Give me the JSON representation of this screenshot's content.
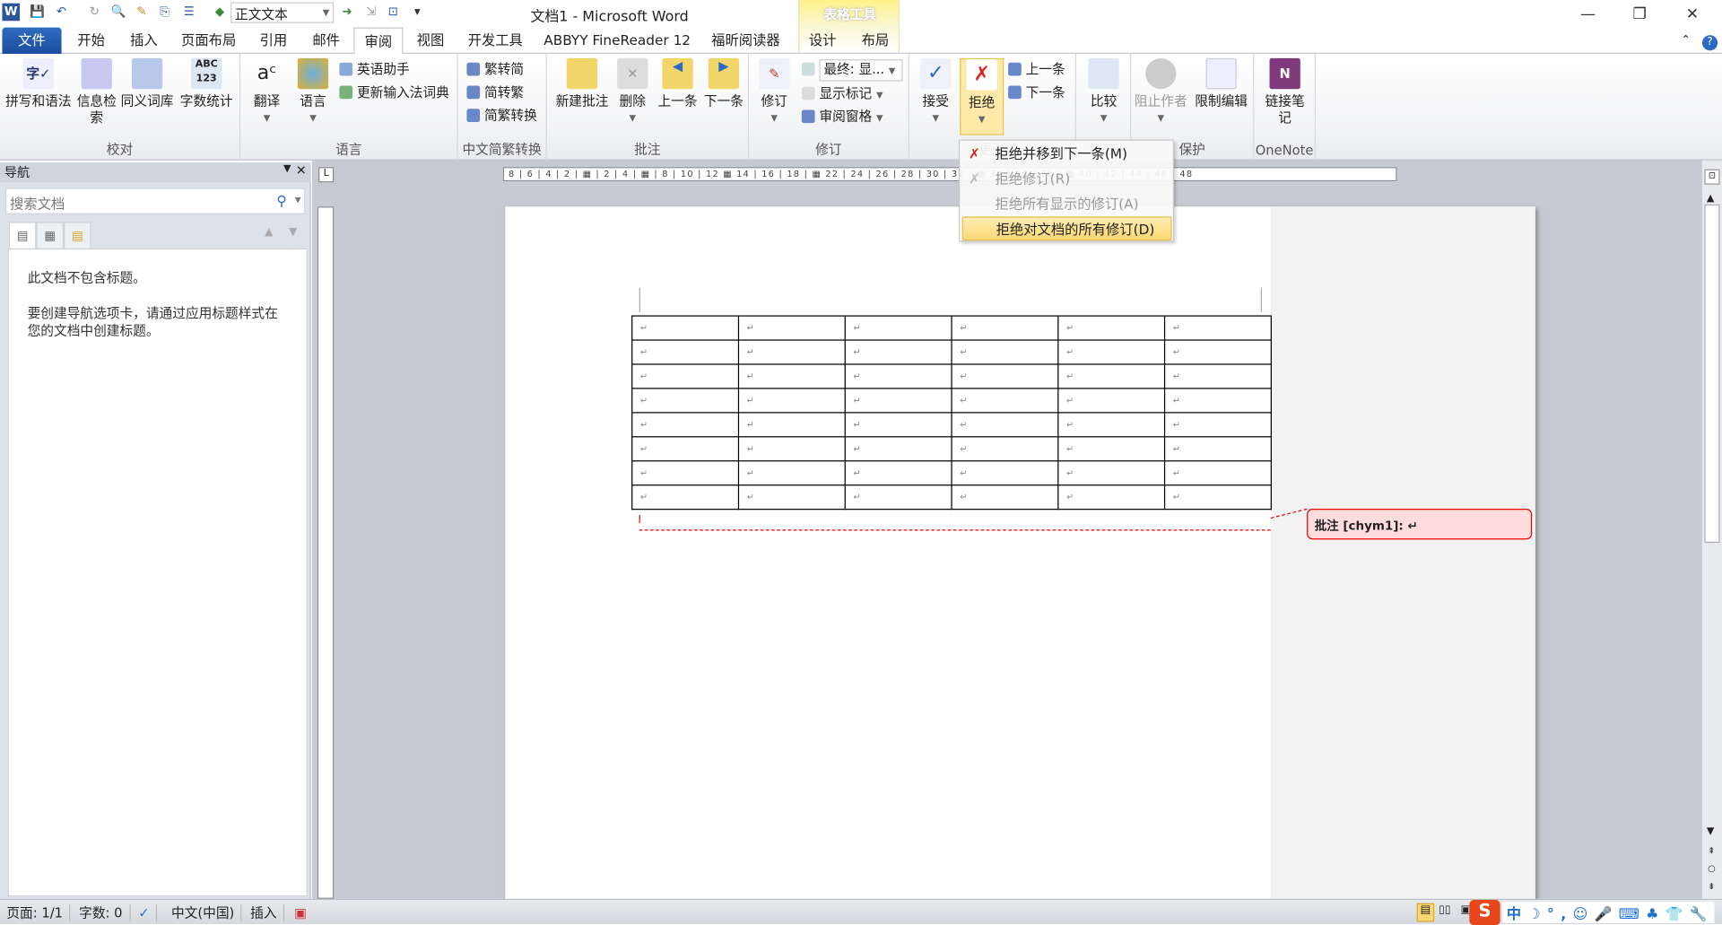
{
  "titlebar": {
    "title": "文档1 - Microsoft Word",
    "style_box": "正文文本",
    "contextual_tab": "表格工具"
  },
  "tabs": [
    "文件",
    "开始",
    "插入",
    "页面布局",
    "引用",
    "邮件",
    "审阅",
    "视图",
    "开发工具",
    "ABBYY FineReader 12",
    "福昕阅读器",
    "设计",
    "布局"
  ],
  "active_tab": "审阅",
  "ribbon": {
    "proofing": {
      "label": "校对",
      "buttons": [
        "拼写和语法",
        "信息检索",
        "同义词库",
        "字数统计"
      ]
    },
    "language": {
      "label": "语言",
      "buttons": [
        "翻译",
        "语言"
      ],
      "small": [
        "英语助手",
        "更新输入法词典"
      ]
    },
    "chinese": {
      "label": "中文简繁转换",
      "small": [
        "繁转简",
        "简转繁",
        "简繁转换"
      ]
    },
    "comments": {
      "label": "批注",
      "buttons": [
        "新建批注",
        "删除",
        "上一条",
        "下一条"
      ]
    },
    "tracking": {
      "label": "修订",
      "button": "修订",
      "display_select": "最终: 显...",
      "small": [
        "显示标记",
        "审阅窗格"
      ]
    },
    "changes": {
      "label": "更改",
      "buttons": [
        "接受",
        "拒绝"
      ],
      "small": [
        "上一条",
        "下一条"
      ]
    },
    "compare": {
      "label": "比较",
      "button": "比较"
    },
    "protect": {
      "label": "保护",
      "buttons": [
        "阻止作者",
        "限制编辑"
      ]
    },
    "onenote": {
      "label": "OneNote",
      "button": "链接笔记"
    }
  },
  "reject_menu": {
    "items": [
      "拒绝并移到下一条(M)",
      "拒绝修订(R)",
      "拒绝所有显示的修订(A)",
      "拒绝对文档的所有修订(D)"
    ],
    "highlighted": "拒绝对文档的所有修订(D)"
  },
  "nav": {
    "title": "导航",
    "search_placeholder": "搜索文档",
    "message1": "此文档不包含标题。",
    "message2": "要创建导航选项卡，请通过应用标题样式在您的文档中创建标题。"
  },
  "ruler": {
    "marks": "8 | 6 | 4 | 2 | ▦ | 2 | 4 | ▦ | 8 | 10 | 12 ▦ 14 | 16 | 18 | ▦ 22 | 24 | 26 | 28 | 30 | 32 | ▦ 34 | 36 | 38 | ▦ 40 | 42 | 44 | 46 | 48"
  },
  "document": {
    "table": {
      "rows": 8,
      "cols": 6,
      "cell_mark": "↵"
    },
    "comment": "批注 [chym1]: ↵"
  },
  "status": {
    "page": "页面: 1/1",
    "words": "字数: 0",
    "language": "中文(中国)",
    "mode": "插入"
  },
  "ime": {
    "items": [
      "中",
      "☽",
      "°,",
      "☺",
      "🎤",
      "⌨",
      "♣",
      "👕",
      "🔧"
    ]
  }
}
